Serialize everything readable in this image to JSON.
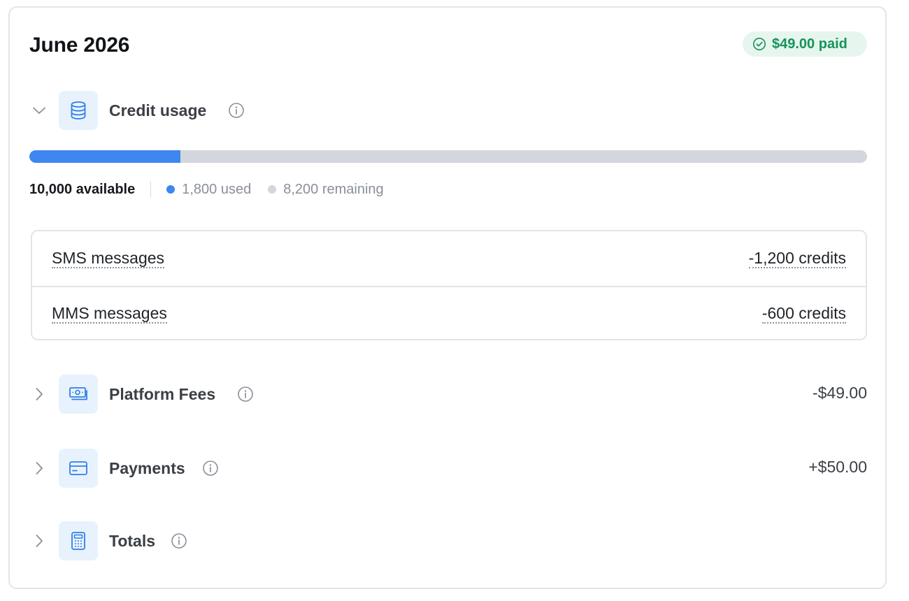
{
  "period": {
    "title": "June 2026",
    "paid_badge": "$49.00 paid"
  },
  "credit_usage": {
    "label": "Credit usage",
    "expanded": true,
    "available_label": "10,000 available",
    "used_label": "1,800 used",
    "remaining_label": "8,200 remaining",
    "used_fraction": 0.18,
    "line_items": [
      {
        "name": "SMS messages",
        "amount": "-1,200 credits"
      },
      {
        "name": "MMS messages",
        "amount": "-600 credits"
      }
    ]
  },
  "sections": [
    {
      "label": "Platform Fees",
      "amount": "-$49.00",
      "icon": "money-icon"
    },
    {
      "label": "Payments",
      "amount": "+$50.00",
      "icon": "credit-card-icon"
    },
    {
      "label": "Totals",
      "amount": "",
      "icon": "calculator-icon"
    }
  ],
  "colors": {
    "accent_blue": "#3e86f0",
    "track_gray": "#d3d6dc",
    "paid_green": "#17925a",
    "paid_bg": "#e6f6ee",
    "icon_tile_bg": "#e8f2fd"
  }
}
